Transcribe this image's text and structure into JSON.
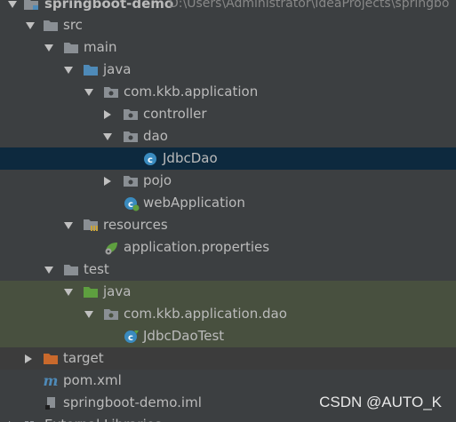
{
  "project": {
    "name": "springboot-demo",
    "path": "D:\\Users\\Administrator\\IdeaProjects\\springbo"
  },
  "tree": {
    "src": "src",
    "main": "main",
    "java": "java",
    "package": "com.kkb.application",
    "controller": "controller",
    "dao": "dao",
    "jdbc_dao": "JdbcDao",
    "pojo": "pojo",
    "web_application": "webApplication",
    "resources": "resources",
    "application_properties": "application.properties",
    "test": "test",
    "test_java": "java",
    "test_package": "com.kkb.application.dao",
    "jdbc_dao_test": "JdbcDaoTest",
    "target": "target",
    "pom": "pom.xml",
    "iml": "springboot-demo.iml",
    "external": "External Libraries"
  },
  "watermark": "CSDN @AUTO_K",
  "colors": {
    "background": "#3c3f41",
    "selected_row": "#0d293e",
    "test_rows": "#48503f",
    "text": "#bbbbbb",
    "folder": "#8a8f94",
    "source_folder": "#4e8ab8",
    "test_folder": "#5e9f3f",
    "excluded_folder": "#c9692c",
    "class_icon": "#3a8bbf"
  }
}
